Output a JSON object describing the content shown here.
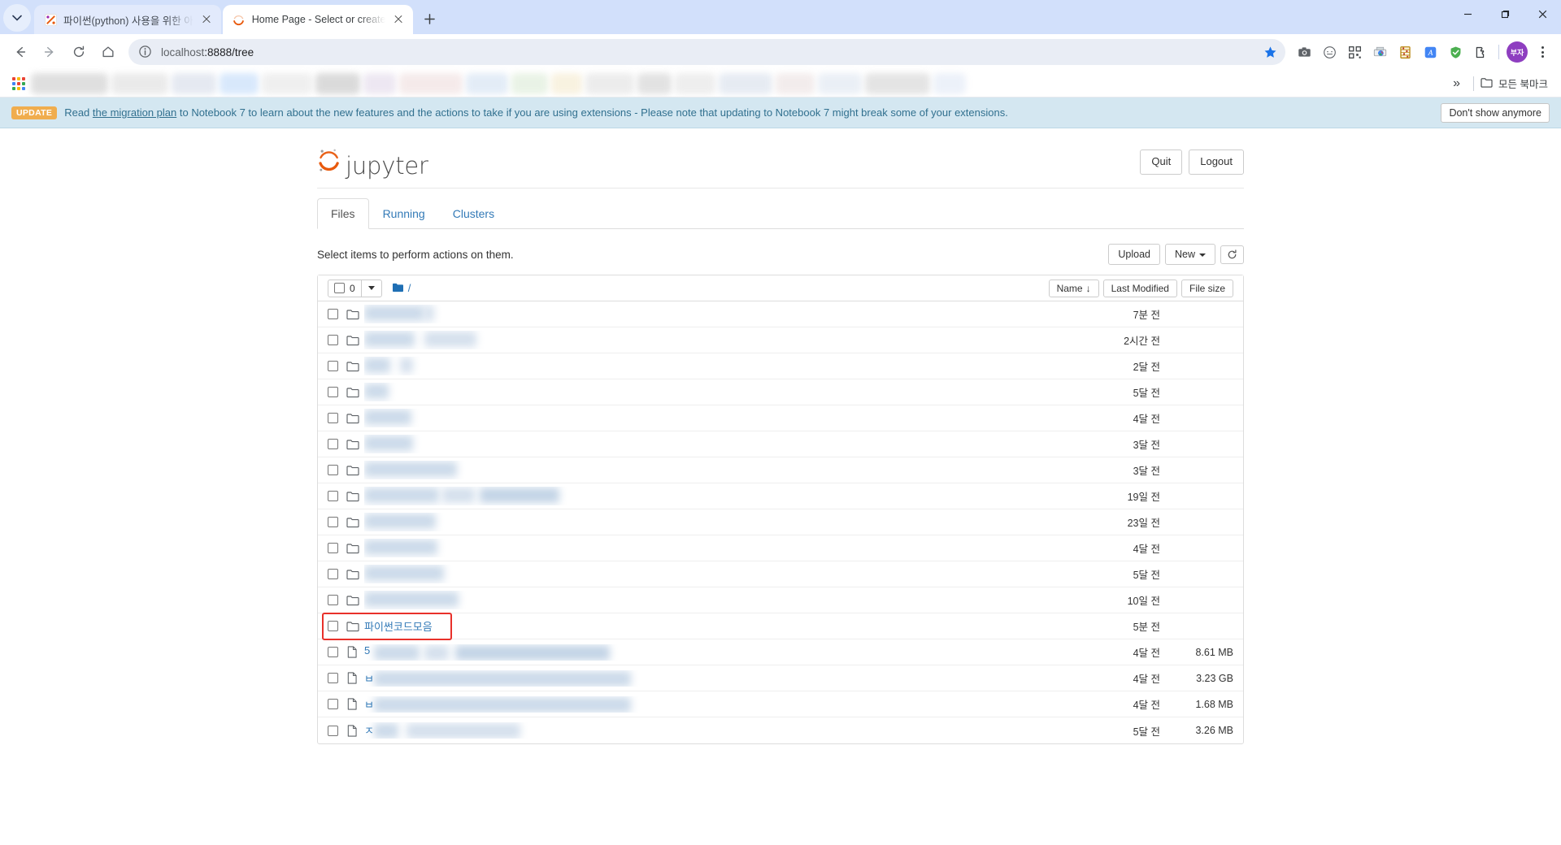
{
  "browser": {
    "tabs": [
      {
        "title": "파이썬(python) 사용을 위한 아",
        "favicon": "jupyter-nbviewer-icon",
        "active": false
      },
      {
        "title": "Home Page - Select or create",
        "favicon": "jupyter-icon",
        "active": true
      }
    ],
    "new_tab_label": "+",
    "window_controls": [
      "minimize",
      "maximize",
      "close"
    ],
    "nav": {
      "back": "back-arrow",
      "forward": "forward-arrow",
      "reload": "reload-icon",
      "home": "home-icon"
    },
    "omnibox": {
      "url_dim": "localhost",
      "url_rest": ":8888/tree",
      "info_icon": "site-info-icon",
      "star_icon": "bookmark-star-icon",
      "star_color": "#1a73e8"
    },
    "extensions": [
      "camera-icon",
      "circle-face-icon",
      "qr-scan-icon",
      "print-cloud-icon",
      "abacus-icon",
      "translate-icon",
      "adblock-shield-icon",
      "extensions-puzzle-icon"
    ],
    "profile_initials": "부자",
    "profile_color": "#8e3ec0",
    "menu_icon": "three-dot-menu-icon",
    "bookmarks": {
      "apps_icon": "apps-grid-icon",
      "overflow_label": "»",
      "all_bookmarks_label": "모든 북마크",
      "folder_icon": "folder-icon",
      "blurred_item_widths": [
        95,
        70,
        55,
        48,
        62,
        55,
        40,
        78,
        52,
        45,
        38,
        60,
        42,
        50,
        66,
        48,
        54,
        80,
        40
      ]
    }
  },
  "notice": {
    "badge": "UPDATE",
    "text_before": "Read ",
    "link": "the migration plan",
    "text_after": " to Notebook 7 to learn about the new features and the actions to take if you are using extensions - Please note that updating to Notebook 7 might break some of your extensions.",
    "dismiss_label": "Don't show anymore"
  },
  "jupyter": {
    "logo_text": "jupyter",
    "quit_label": "Quit",
    "logout_label": "Logout",
    "tabs": [
      {
        "label": "Files",
        "selected": true
      },
      {
        "label": "Running",
        "selected": false
      },
      {
        "label": "Clusters",
        "selected": false
      }
    ],
    "action_hint": "Select items to perform actions on them.",
    "upload_label": "Upload",
    "new_label": "New",
    "refresh_icon": "refresh-icon",
    "selected_count": "0",
    "breadcrumb_root": "/",
    "sort": {
      "name_label": "Name",
      "name_arrow": "↓",
      "last_modified_label": "Last Modified",
      "file_size_label": "File size"
    },
    "rows": [
      {
        "type": "folder",
        "name": "",
        "blurred": true,
        "prefix": "",
        "blur_segments": [
          [
            0,
            74
          ],
          [
            74,
            12
          ]
        ],
        "modified": "7분 전",
        "size": ""
      },
      {
        "type": "folder",
        "name": "",
        "blurred": true,
        "prefix": "",
        "blur_segments": [
          [
            0,
            62
          ],
          [
            74,
            64
          ]
        ],
        "modified": "2시간 전",
        "size": ""
      },
      {
        "type": "folder",
        "name": "",
        "blurred": true,
        "prefix": "",
        "blur_segments": [
          [
            0,
            32
          ],
          [
            44,
            16
          ]
        ],
        "modified": "2달 전",
        "size": ""
      },
      {
        "type": "folder",
        "name": "",
        "blurred": true,
        "prefix": "",
        "blur_segments": [
          [
            0,
            30
          ]
        ],
        "modified": "5달 전",
        "size": ""
      },
      {
        "type": "folder",
        "name": "",
        "blurred": true,
        "prefix": "",
        "blur_segments": [
          [
            0,
            58
          ]
        ],
        "modified": "4달 전",
        "size": ""
      },
      {
        "type": "folder",
        "name": "",
        "blurred": true,
        "prefix": "",
        "blur_segments": [
          [
            0,
            60
          ]
        ],
        "modified": "3달 전",
        "size": ""
      },
      {
        "type": "folder",
        "name": "",
        "blurred": true,
        "prefix": "",
        "blur_segments": [
          [
            0,
            114
          ]
        ],
        "modified": "3달 전",
        "size": ""
      },
      {
        "type": "folder",
        "name": "",
        "blurred": true,
        "prefix": "",
        "blur_segments": [
          [
            0,
            92
          ],
          [
            96,
            40
          ],
          [
            142,
            98
          ]
        ],
        "modified": "19일 전",
        "size": ""
      },
      {
        "type": "folder",
        "name": "",
        "blurred": true,
        "prefix": "",
        "blur_segments": [
          [
            0,
            88
          ]
        ],
        "modified": "23일 전",
        "size": ""
      },
      {
        "type": "folder",
        "name": "",
        "blurred": true,
        "prefix": "",
        "blur_segments": [
          [
            0,
            90
          ]
        ],
        "modified": "4달 전",
        "size": ""
      },
      {
        "type": "folder",
        "name": "",
        "blurred": true,
        "prefix": "",
        "blur_segments": [
          [
            0,
            98
          ]
        ],
        "modified": "5달 전",
        "size": ""
      },
      {
        "type": "folder",
        "name": "",
        "blurred": true,
        "prefix": "",
        "blur_segments": [
          [
            0,
            116
          ]
        ],
        "modified": "10일 전",
        "size": ""
      },
      {
        "type": "folder",
        "name": "파이썬코드모음",
        "blurred": false,
        "prefix": "",
        "blur_segments": [],
        "modified": "5분 전",
        "size": "",
        "highlighted": true
      },
      {
        "type": "file",
        "name": "",
        "blurred": true,
        "prefix": "5",
        "blur_segments": [
          [
            0,
            56
          ],
          [
            62,
            30
          ],
          [
            100,
            190
          ]
        ],
        "modified": "4달 전",
        "size": "8.61 MB"
      },
      {
        "type": "file",
        "name": "",
        "blurred": true,
        "prefix": "ㅂ",
        "blur_segments": [
          [
            0,
            316
          ]
        ],
        "modified": "4달 전",
        "size": "3.23 GB"
      },
      {
        "type": "file",
        "name": "",
        "blurred": true,
        "prefix": "ㅂ",
        "blur_segments": [
          [
            0,
            316
          ]
        ],
        "modified": "4달 전",
        "size": "1.68 MB"
      },
      {
        "type": "file",
        "name": "",
        "blurred": true,
        "prefix": "ㅈ",
        "blur_segments": [
          [
            0,
            30
          ],
          [
            40,
            140
          ]
        ],
        "modified": "5달 전",
        "size": "3.26 MB"
      }
    ]
  },
  "annotation": {
    "type": "red-rectangle",
    "color": "#e8302a",
    "targets_row_index": 12
  }
}
